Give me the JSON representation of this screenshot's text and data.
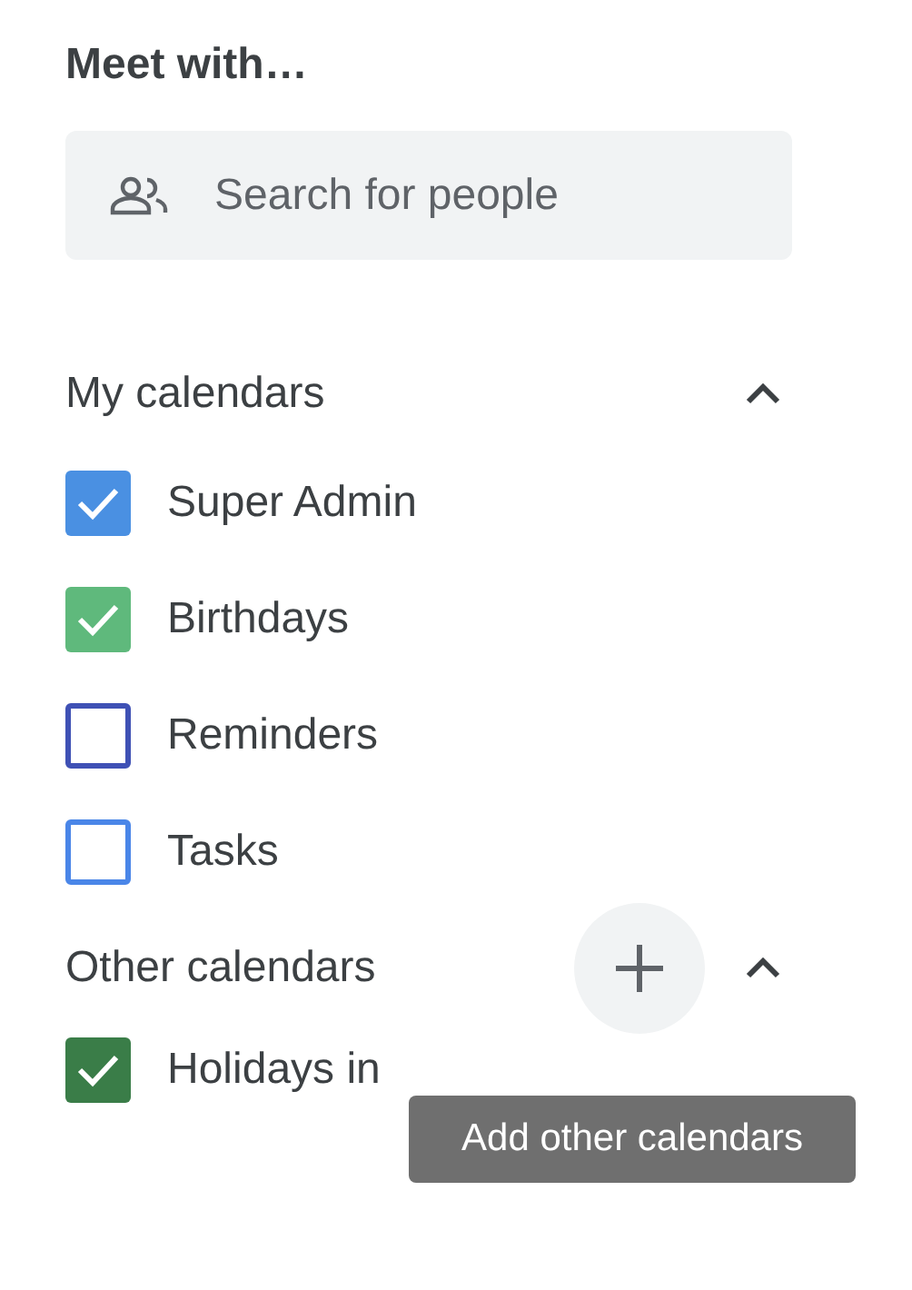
{
  "meet": {
    "title": "Meet with…",
    "search": {
      "placeholder": "Search for people"
    }
  },
  "my_calendars": {
    "title": "My calendars",
    "expanded": true,
    "items": [
      {
        "label": "Super Admin",
        "checked": true,
        "color": "#4a90e2"
      },
      {
        "label": "Birthdays",
        "checked": true,
        "color": "#5fb97c"
      },
      {
        "label": "Reminders",
        "checked": false,
        "color": "#3f51b5"
      },
      {
        "label": "Tasks",
        "checked": false,
        "color": "#4a86e8"
      }
    ]
  },
  "other_calendars": {
    "title": "Other calendars",
    "expanded": true,
    "items": [
      {
        "label": "Holidays in",
        "checked": true,
        "color": "#3a7d48"
      }
    ]
  },
  "tooltip": {
    "text": "Add other calendars"
  }
}
